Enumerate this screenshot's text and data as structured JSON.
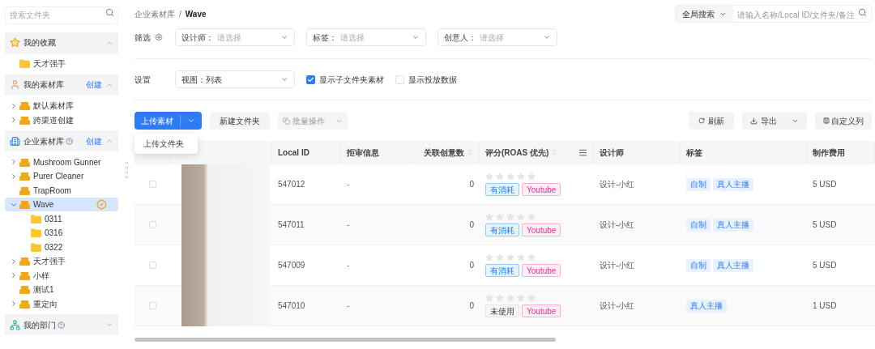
{
  "sidebar": {
    "search": {
      "placeholder": "搜索文件夹"
    },
    "sections": [
      {
        "kind": "favorites",
        "title": "我的收藏",
        "help": false,
        "expanded": true,
        "items": [
          {
            "label": "天才强手",
            "kind": "folder",
            "selected": false,
            "badge": false,
            "has_children": false
          }
        ]
      },
      {
        "kind": "personal",
        "title": "我的素材库",
        "help": false,
        "create": "创建",
        "expanded": true,
        "items": [
          {
            "label": "默认素材库",
            "kind": "library",
            "expanded": false,
            "selected": false,
            "badge": false,
            "has_children": true
          },
          {
            "label": "跨渠道创建",
            "kind": "library",
            "expanded": false,
            "selected": false,
            "badge": false,
            "has_children": true
          }
        ]
      },
      {
        "kind": "enterprise",
        "title": "企业素材库",
        "help": true,
        "create": "创建",
        "expanded": true,
        "items": [
          {
            "label": "Mushroom Gunner",
            "kind": "library",
            "expanded": false,
            "selected": false,
            "badge": false,
            "has_children": true
          },
          {
            "label": "Purer Cleaner",
            "kind": "library",
            "expanded": false,
            "selected": false,
            "badge": false,
            "has_children": true
          },
          {
            "label": "TrapRoom",
            "kind": "library",
            "selected": false,
            "badge": false,
            "has_children": false
          },
          {
            "label": "Wave",
            "kind": "library",
            "expanded": true,
            "selected": true,
            "badge": true,
            "has_children": true,
            "children": [
              {
                "label": "0311",
                "kind": "folder",
                "selected": false,
                "badge": false,
                "has_children": false
              },
              {
                "label": "0316",
                "kind": "folder",
                "selected": false,
                "badge": false,
                "has_children": false
              },
              {
                "label": "0322",
                "kind": "folder",
                "selected": false,
                "badge": false,
                "has_children": false
              }
            ]
          },
          {
            "label": "天才强手",
            "kind": "library",
            "expanded": false,
            "selected": false,
            "badge": false,
            "has_children": true
          },
          {
            "label": "小样",
            "kind": "library",
            "expanded": false,
            "selected": false,
            "badge": false,
            "has_children": true
          },
          {
            "label": "测试1",
            "kind": "library",
            "selected": false,
            "badge": false,
            "has_children": false
          },
          {
            "label": "重定向",
            "kind": "library",
            "expanded": false,
            "selected": false,
            "badge": false,
            "has_children": true
          }
        ]
      },
      {
        "kind": "department",
        "title": "我的部门",
        "help": true,
        "expanded": false
      }
    ]
  },
  "breadcrumb": {
    "items": [
      "企业素材库",
      "Wave"
    ],
    "separator": "/"
  },
  "global_search": {
    "scope": "全局搜索",
    "placeholder": "请输入名称/Local ID/文件夹/备注"
  },
  "filters": {
    "label": "筛选",
    "selects": [
      {
        "label": "设计师：",
        "placeholder": "请选择"
      },
      {
        "label": "标签：",
        "placeholder": "请选择"
      },
      {
        "label": "创意人：",
        "placeholder": "请选择"
      }
    ]
  },
  "settings": {
    "label": "设置",
    "view": "视图：列表",
    "checkboxes": [
      {
        "label": "显示子文件夹素材",
        "checked": true
      },
      {
        "label": "显示投放数据",
        "checked": false
      }
    ]
  },
  "toolbar": {
    "upload": "上传素材",
    "upload_menu": [
      "上传文件夹"
    ],
    "new_folder": "新建文件夹",
    "batch": "批量操作",
    "refresh": "刷新",
    "export": "导出",
    "columns": "自定义列"
  },
  "table": {
    "columns": [
      "Local ID",
      "拒审信息",
      "关联创意数",
      "评分(ROAS 优先)",
      "设计师",
      "标签",
      "制作费用"
    ],
    "rows": [
      {
        "checked": false,
        "local_id": "547012",
        "reject": "-",
        "linked": "0",
        "stars": 0,
        "status": {
          "text": "有消耗",
          "kind": "consumed"
        },
        "channel": "Youtube",
        "designer": "设计-小红",
        "tags": [
          "自制",
          "真人主播"
        ],
        "cost": "5 USD"
      },
      {
        "checked": false,
        "local_id": "547011",
        "reject": "-",
        "linked": "0",
        "stars": 0,
        "status": {
          "text": "有消耗",
          "kind": "consumed"
        },
        "channel": "Youtube",
        "designer": "设计-小红",
        "tags": [
          "自制",
          "真人主播"
        ],
        "cost": "5 USD"
      },
      {
        "checked": false,
        "local_id": "547009",
        "reject": "-",
        "linked": "0",
        "stars": 0,
        "status": {
          "text": "有消耗",
          "kind": "consumed"
        },
        "channel": "Youtube",
        "designer": "设计-小红",
        "tags": [
          "自制",
          "真人主播"
        ],
        "cost": "5 USD"
      },
      {
        "checked": false,
        "local_id": "547010",
        "reject": "-",
        "linked": "0",
        "stars": 0,
        "status": {
          "text": "未使用",
          "kind": "unused"
        },
        "channel": "Youtube",
        "designer": "设计-小红",
        "tags": [
          "真人主播"
        ],
        "cost": "1 USD"
      }
    ]
  }
}
